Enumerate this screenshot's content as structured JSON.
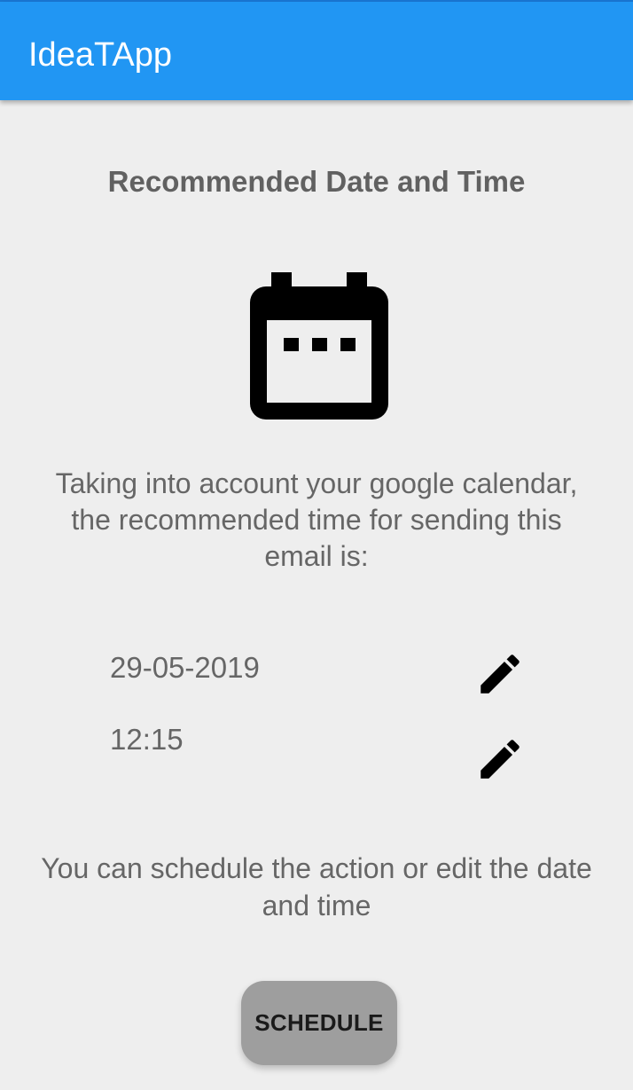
{
  "app_bar": {
    "title": "IdeaTApp",
    "background_color": "#2196f3"
  },
  "main": {
    "heading": "Recommended Date and Time",
    "icon": "calendar-icon",
    "description": "Taking into account your google calendar, the recommended time for sending this email is:",
    "date": {
      "value": "29-05-2019",
      "edit_icon": "pencil-icon"
    },
    "time": {
      "value": "12:15",
      "edit_icon": "pencil-icon"
    },
    "footer_text": "You can schedule the action or edit the date and time",
    "schedule_button": {
      "label": "SCHEDULE",
      "background_color": "#9e9e9e"
    }
  }
}
